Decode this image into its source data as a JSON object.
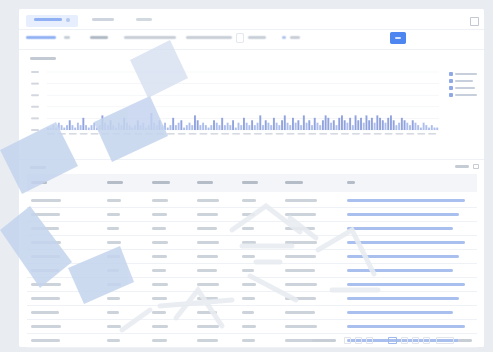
{
  "colors": {
    "accent": "#4d86f0",
    "bar": "#9fb3ea",
    "bar_dense": "#7d93d8",
    "background": "#e9edf2",
    "watermark_blue": "#c9d6ec"
  },
  "icons": {
    "top_right": "window-toggle-icon",
    "search_button": "search-icon",
    "toolbar_settings": "settings-icon"
  },
  "chart_data": {
    "type": "bar",
    "values": [
      1,
      1,
      2,
      1,
      3,
      2,
      1,
      2,
      4,
      2,
      1,
      3,
      2,
      5,
      2,
      1,
      2,
      3,
      1,
      2,
      6,
      3,
      2,
      4,
      2,
      1,
      3,
      2,
      5,
      3,
      2,
      1,
      2,
      4,
      2,
      3,
      1,
      2,
      7,
      3,
      2,
      4,
      2,
      3,
      1,
      2,
      5,
      2,
      3,
      4,
      1,
      2,
      3,
      2,
      6,
      4,
      2,
      3,
      2,
      1,
      2,
      4,
      3,
      2,
      5,
      2,
      3,
      2,
      4,
      1,
      3,
      2,
      5,
      3,
      2,
      4,
      2,
      3,
      6,
      2,
      4,
      3,
      2,
      5,
      3,
      2,
      4,
      6,
      3,
      2,
      5,
      3,
      4,
      2,
      6,
      3,
      4,
      2,
      5,
      3,
      2,
      4,
      6,
      5,
      3,
      4,
      2,
      5,
      6,
      4,
      3,
      5,
      2,
      6,
      4,
      5,
      3,
      6,
      4,
      5,
      3,
      6,
      5,
      4,
      3,
      5,
      6,
      4,
      2,
      3,
      5,
      4,
      3,
      2,
      4,
      3,
      2,
      1,
      3,
      2,
      1,
      2,
      1,
      1
    ],
    "ylim": [
      0,
      10
    ],
    "grid": true,
    "legend_position": "right"
  },
  "table": {
    "row_count": 11,
    "column_count": 8
  }
}
